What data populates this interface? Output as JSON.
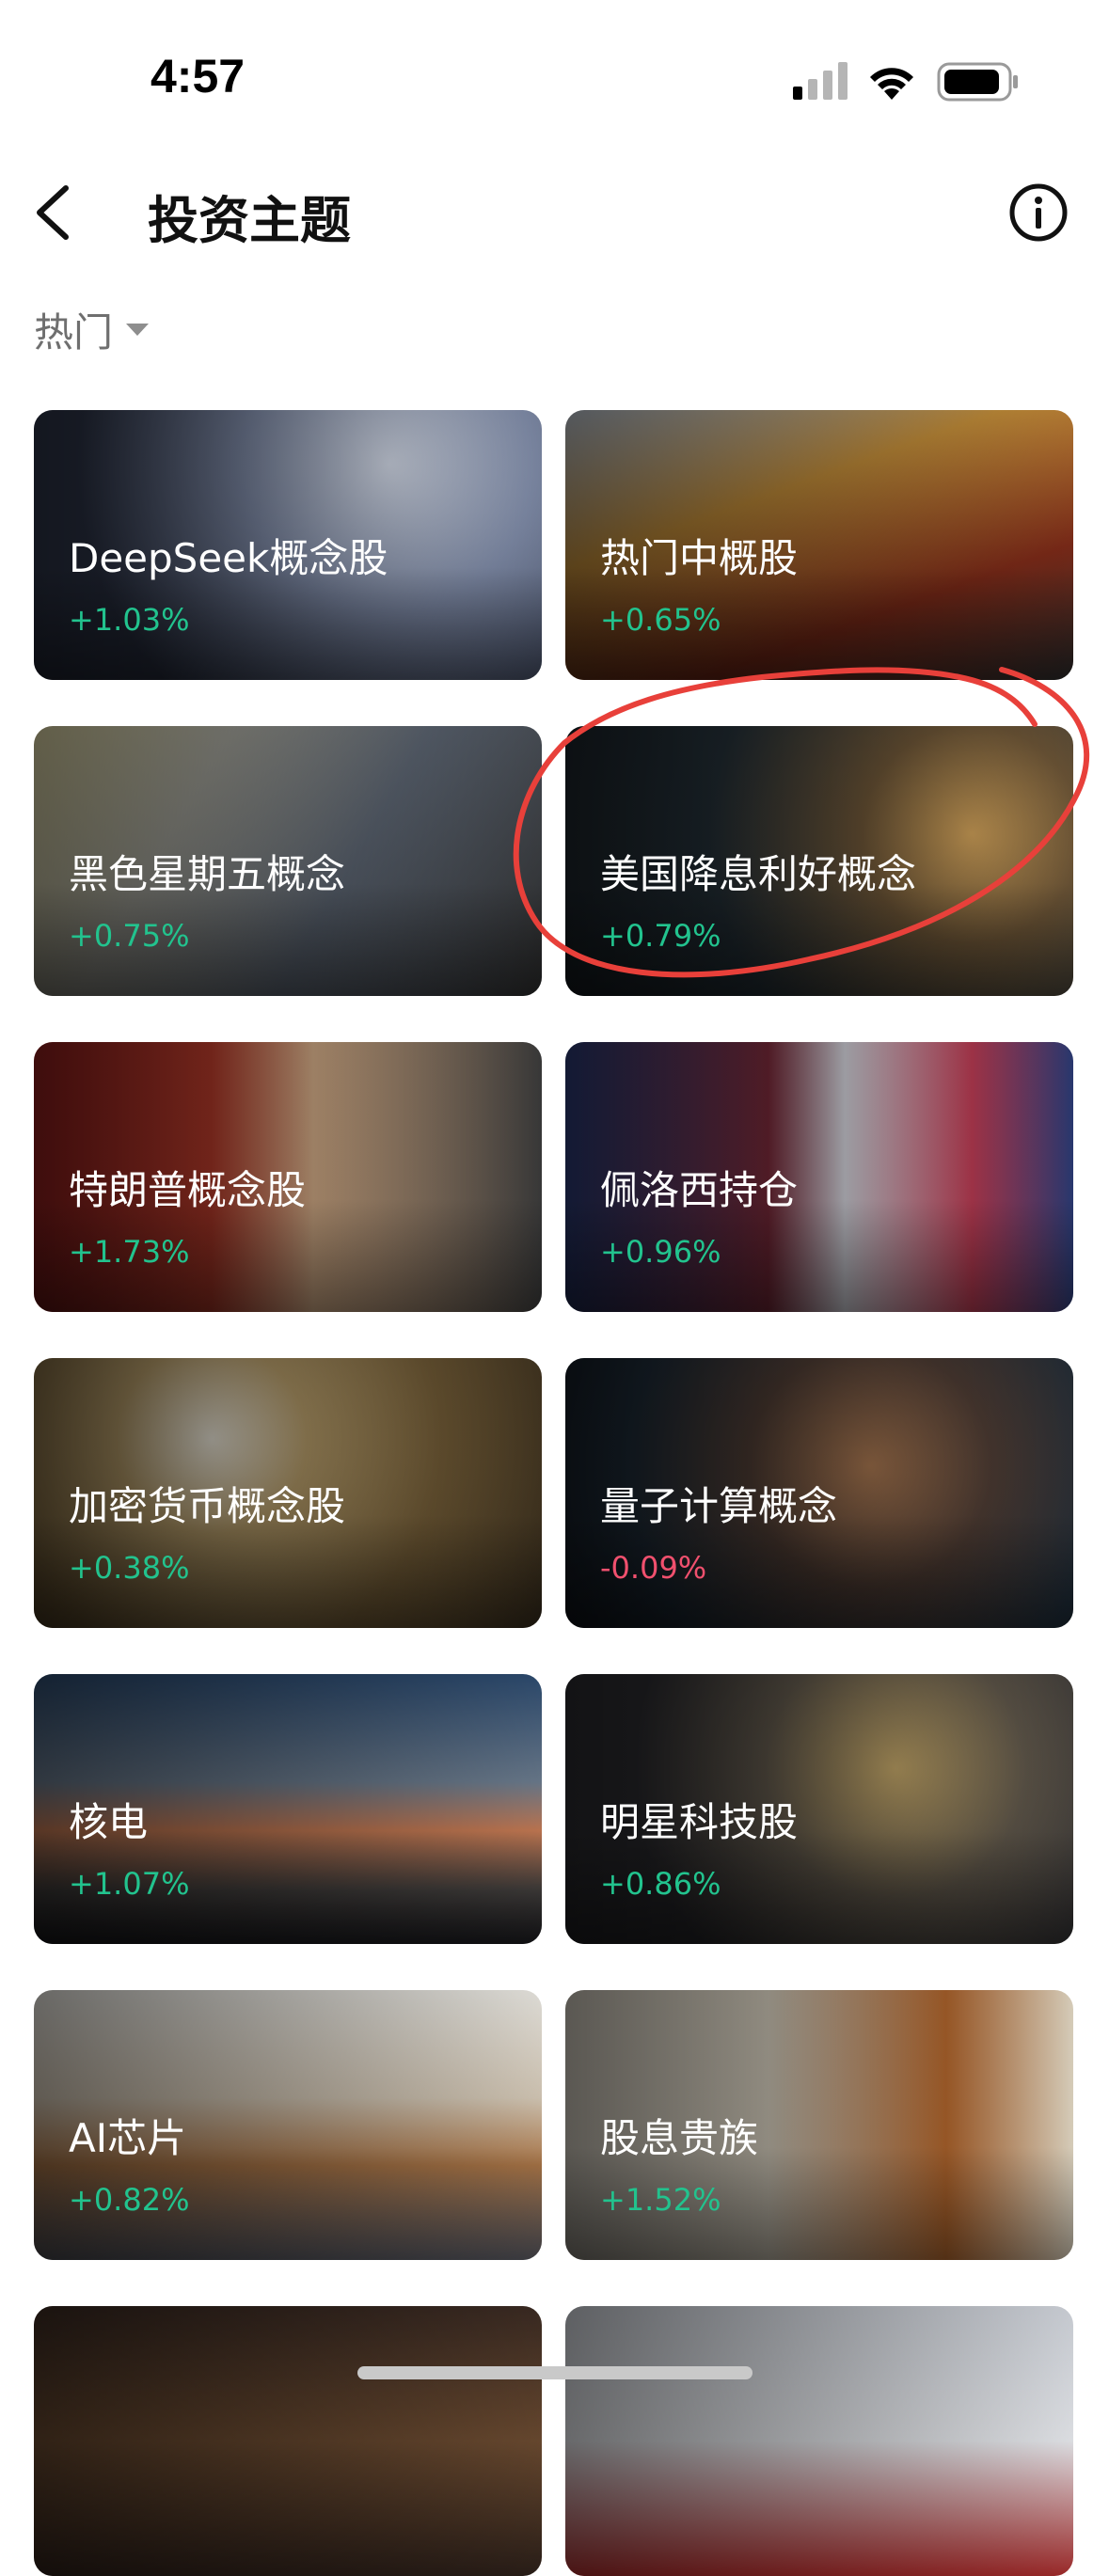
{
  "status_bar": {
    "time": "4:57",
    "signal_icon": "cellular-signal-icon",
    "wifi_icon": "wifi-icon",
    "battery_icon": "battery-icon"
  },
  "nav": {
    "back_icon": "chevron-left-icon",
    "title": "投资主题",
    "info_icon": "info-icon"
  },
  "filter": {
    "label": "热门",
    "caret_icon": "caret-down-icon"
  },
  "themes": [
    {
      "name": "DeepSeek概念股",
      "change": "+1.03%",
      "direction": "up"
    },
    {
      "name": "热门中概股",
      "change": "+0.65%",
      "direction": "up"
    },
    {
      "name": "黑色星期五概念",
      "change": "+0.75%",
      "direction": "up"
    },
    {
      "name": "美国降息利好概念",
      "change": "+0.79%",
      "direction": "up"
    },
    {
      "name": "特朗普概念股",
      "change": "+1.73%",
      "direction": "up"
    },
    {
      "name": "佩洛西持仓",
      "change": "+0.96%",
      "direction": "up"
    },
    {
      "name": "加密货币概念股",
      "change": "+0.38%",
      "direction": "up"
    },
    {
      "name": "量子计算概念",
      "change": "-0.09%",
      "direction": "down"
    },
    {
      "name": "核电",
      "change": "+1.07%",
      "direction": "up"
    },
    {
      "name": "明星科技股",
      "change": "+0.86%",
      "direction": "up"
    },
    {
      "name": "AI芯片",
      "change": "+0.82%",
      "direction": "up"
    },
    {
      "name": "股息贵族",
      "change": "+1.52%",
      "direction": "up"
    }
  ],
  "colors": {
    "up": "#22c38e",
    "down": "#f0506e",
    "highlight_circle": "#e8403a"
  }
}
